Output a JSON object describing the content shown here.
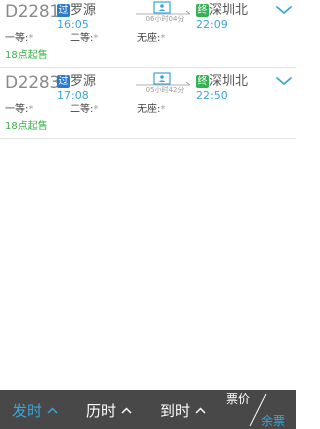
{
  "trains": [
    {
      "train_no": "D2281",
      "dep_badge": "过",
      "dep_station": "罗源",
      "dep_time": "16:05",
      "duration": "06小时04分",
      "arr_badge": "终",
      "arr_station": "深圳北",
      "arr_time": "22:09",
      "seats": [
        {
          "label": "一等:",
          "value": "*"
        },
        {
          "label": "二等:",
          "value": "*"
        },
        {
          "label": "无座:",
          "value": "*"
        }
      ],
      "sale_note": "18点起售"
    },
    {
      "train_no": "D2283",
      "dep_badge": "过",
      "dep_station": "罗源",
      "dep_time": "17:08",
      "duration": "05小时42分",
      "arr_badge": "终",
      "arr_station": "深圳北",
      "arr_time": "22:50",
      "seats": [
        {
          "label": "一等:",
          "value": "*"
        },
        {
          "label": "二等:",
          "value": "*"
        },
        {
          "label": "无座:",
          "value": "*"
        }
      ],
      "sale_note": "18点起售"
    }
  ],
  "bottom_bar": {
    "sort_depart": "发时",
    "sort_duration": "历时",
    "sort_arrive": "到时",
    "toggle_price": "票价",
    "toggle_remaining": "余票"
  },
  "colors": {
    "accent_blue": "#3aa5d9",
    "pass_badge": "#2a7ad0",
    "terminal_badge": "#35b156",
    "sale_green": "#3bb04d",
    "bottom_bar_bg": "#484848"
  },
  "icons": {
    "route": "train-route-icon",
    "expand": "chevron-down-icon",
    "sort_caret": "caret-up-icon"
  }
}
